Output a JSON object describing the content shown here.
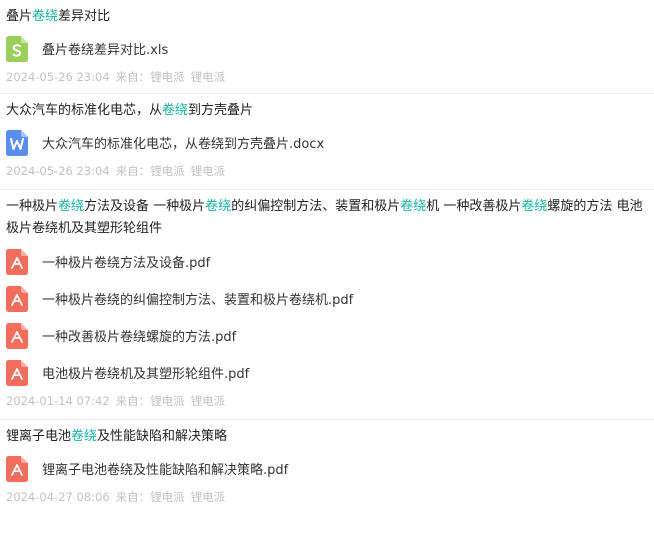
{
  "results": [
    {
      "title_parts": [
        {
          "text": "叠片",
          "hl": false
        },
        {
          "text": "卷绕",
          "hl": true
        },
        {
          "text": "差异对比",
          "hl": false
        }
      ],
      "files": [
        {
          "name": "叠片卷绕差异对比.xls",
          "icon": "spreadsheet-icon",
          "color": "#9bcf5c"
        }
      ],
      "date": "2024-05-26 23:04",
      "from_label": "来自：",
      "source": "锂电派",
      "source2": "锂电派"
    },
    {
      "title_parts": [
        {
          "text": "大众汽车的标准化电芯，从",
          "hl": false
        },
        {
          "text": "卷绕",
          "hl": true
        },
        {
          "text": "到方壳叠片",
          "hl": false
        }
      ],
      "files": [
        {
          "name": "大众汽车的标准化电芯，从卷绕到方壳叠片.docx",
          "icon": "word-doc-icon",
          "color": "#5b8def"
        }
      ],
      "date": "2024-05-26 23:04",
      "from_label": "来自：",
      "source": "锂电派",
      "source2": "锂电派"
    },
    {
      "title_parts": [
        {
          "text": "一种极片",
          "hl": false
        },
        {
          "text": "卷绕",
          "hl": true
        },
        {
          "text": "方法及设备 一种极片",
          "hl": false
        },
        {
          "text": "卷绕",
          "hl": true
        },
        {
          "text": "的纠偏控制方法、装置和极片",
          "hl": false
        },
        {
          "text": "卷绕",
          "hl": true
        },
        {
          "text": "机 一种改善极片",
          "hl": false
        },
        {
          "text": "卷绕",
          "hl": true
        },
        {
          "text": "螺旋的方法 电池极片卷绕机及其塑形轮组件",
          "hl": false
        }
      ],
      "files": [
        {
          "name": "一种极片卷绕方法及设备.pdf",
          "icon": "pdf-icon",
          "color": "#f26d5b"
        },
        {
          "name": "一种极片卷绕的纠偏控制方法、装置和极片卷绕机.pdf",
          "icon": "pdf-icon",
          "color": "#f26d5b"
        },
        {
          "name": "一种改善极片卷绕螺旋的方法.pdf",
          "icon": "pdf-icon",
          "color": "#f26d5b"
        },
        {
          "name": "电池极片卷绕机及其塑形轮组件.pdf",
          "icon": "pdf-icon",
          "color": "#f26d5b"
        }
      ],
      "date": "2024-01-14 07:42",
      "from_label": "来自：",
      "source": "锂电派",
      "source2": "锂电派"
    },
    {
      "title_parts": [
        {
          "text": "锂离子电池",
          "hl": false
        },
        {
          "text": "卷绕",
          "hl": true
        },
        {
          "text": "及性能缺陷和解决策略",
          "hl": false
        }
      ],
      "files": [
        {
          "name": "锂离子电池卷绕及性能缺陷和解决策略.pdf",
          "icon": "pdf-icon",
          "color": "#f26d5b"
        }
      ],
      "date": "2024-04-27 08:06",
      "from_label": "来自：",
      "source": "锂电派",
      "source2": "锂电派"
    }
  ]
}
